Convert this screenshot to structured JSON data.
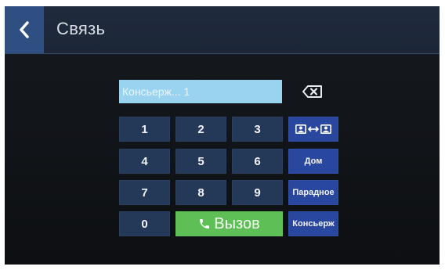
{
  "header": {
    "title": "Связь",
    "back_icon": "chevron-left-icon"
  },
  "display": {
    "value": "Консьерж... 1"
  },
  "backspace": {
    "icon": "backspace-icon"
  },
  "keypad": {
    "digits": [
      "1",
      "2",
      "3",
      "4",
      "5",
      "6",
      "7",
      "8",
      "9",
      "0"
    ],
    "call_label": "Вызов",
    "call_icon": "phone-icon"
  },
  "function_keys": {
    "switch_icon": "contacts-swap-icon",
    "home_label": "Дом",
    "entrance_label": "Парадное",
    "concierge_label": "Консьерж"
  },
  "colors": {
    "topbar": "#1f2a3d",
    "back_button": "#2f4f82",
    "key": "#243858",
    "function_key": "#2a47a0",
    "call_button": "#5dbf55",
    "display": "#9ad3ef"
  }
}
